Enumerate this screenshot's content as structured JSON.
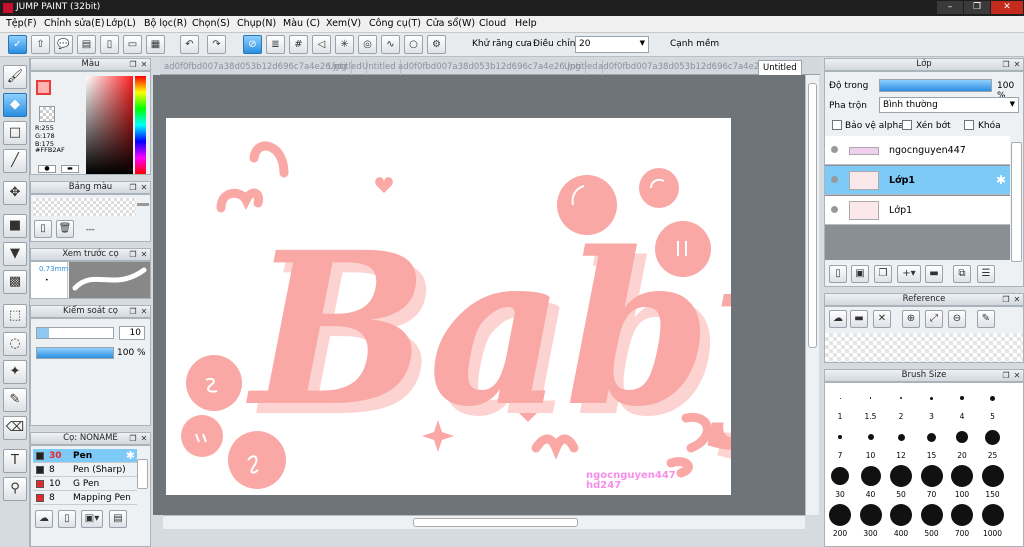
{
  "window": {
    "title": "JUMP PAINT (32bit)"
  },
  "menu": [
    "Tệp(F)",
    "Chỉnh sửa(E)",
    "Lớp(L)",
    "Bộ lọc(R)",
    "Chọn(S)",
    "Chụp(N)",
    "Màu (C)",
    "Xem(V)",
    "Công cụ(T)",
    "Cửa sổ(W)",
    "Cloud",
    "Help"
  ],
  "toolbar": {
    "antialias_label": "Khử răng cưa",
    "adjust_label": "Điều chỉnh",
    "adjust_value": "20",
    "edge_label": "Cạnh mềm"
  },
  "color_panel": {
    "title": "Màu",
    "r": "R:255",
    "g": "G:178",
    "b": "B:175",
    "hex": "#FFB2AF",
    "primary": "#ffb2af"
  },
  "palette_panel": {
    "title": "Bảng màu",
    "dashes": "---"
  },
  "brush_preview": {
    "title": "Xem trước cọ",
    "size": "0.73mm"
  },
  "brush_control": {
    "title": "Kiểm soát cọ",
    "size_value": "10",
    "opacity_value": "100 %",
    "opacity": 1.0
  },
  "brush_list": {
    "title": "Cọ: NONAME",
    "items": [
      {
        "size": "30",
        "name": "Pen",
        "color": "#222222"
      },
      {
        "size": "8",
        "name": "Pen (Sharp)",
        "color": "#222222"
      },
      {
        "size": "10",
        "name": "G Pen",
        "color": "#e8262c"
      },
      {
        "size": "8",
        "name": "Mapping Pen",
        "color": "#e8262c"
      }
    ]
  },
  "tabs": [
    "ad0f0fbd007a38d053b12d696c7a4e26.jpg",
    "Untitled",
    "Untitled",
    "ad0f0fbd007a38d053b12d696c7a4e26.jpg",
    "Untitled",
    "ad0f0fbd007a38d053b12d696c7a4e26.jpg",
    "Untitled"
  ],
  "canvas": {
    "headline": "Baby",
    "watermark_line1": "ngocnguyen447",
    "watermark_line2": "hd247",
    "ink": "#f9a8a5"
  },
  "layer_panel": {
    "title": "Lớp",
    "opacity_label": "Độ trong",
    "opacity_value": "100 %",
    "opacity": 1.0,
    "blend_label": "Pha trộn",
    "blend_value": "Bình thường",
    "protect_alpha": "Bảo vệ alpha",
    "clip": "Xén bớt",
    "lock": "Khóa",
    "layers": [
      {
        "name": "ngocnguyen447",
        "selected": false
      },
      {
        "name": "Lớp1",
        "selected": true
      },
      {
        "name": "Lớp1",
        "selected": false
      }
    ]
  },
  "reference_panel": {
    "title": "Reference"
  },
  "brush_size_panel": {
    "title": "Brush Size",
    "sizes": [
      "1",
      "1.5",
      "2",
      "3",
      "4",
      "5",
      "7",
      "10",
      "12",
      "15",
      "20",
      "25",
      "30",
      "40",
      "50",
      "70",
      "100",
      "150",
      "200",
      "300",
      "400",
      "500",
      "700",
      "1000"
    ]
  }
}
